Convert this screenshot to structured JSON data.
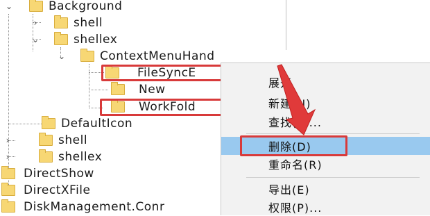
{
  "tree": {
    "items": [
      {
        "label": "Background",
        "expander": "⌄"
      },
      {
        "label": "shell",
        "expander": "›"
      },
      {
        "label": "shellex",
        "expander": "⌄"
      },
      {
        "label": "ContextMenuHand",
        "expander": "⌄"
      },
      {
        "label": "FileSyncE",
        "expander": ""
      },
      {
        "label": "New",
        "expander": ""
      },
      {
        "label": "WorkFold",
        "expander": ""
      },
      {
        "label": "DefaultIcon",
        "expander": ""
      },
      {
        "label": "shell",
        "expander": "›"
      },
      {
        "label": "shellex",
        "expander": "›"
      },
      {
        "label": "DirectShow",
        "expander": ""
      },
      {
        "label": "DirectXFile",
        "expander": ""
      },
      {
        "label": "DiskManagement.Conr",
        "expander": ""
      }
    ]
  },
  "context_menu": {
    "items": [
      {
        "label": "展开"
      },
      {
        "label": "新建(N)"
      },
      {
        "label": "查找(F)..."
      },
      {
        "label": "删除(D)"
      },
      {
        "label": "重命名(R)"
      },
      {
        "label": "导出(E)"
      },
      {
        "label": "权限(P)..."
      }
    ],
    "selected_index": 3
  },
  "colors": {
    "highlight_red": "#d83a3a",
    "selection_blue": "#99c9ef",
    "folder_yellow": "#f7d774"
  }
}
